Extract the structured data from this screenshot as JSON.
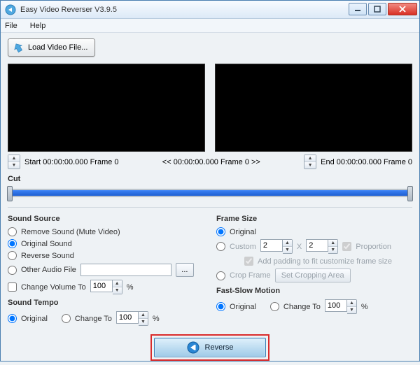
{
  "window": {
    "title": "Easy Video Reverser V3.9.5"
  },
  "menu": {
    "file": "File",
    "help": "Help"
  },
  "buttons": {
    "load": "Load Video File...",
    "browse": "...",
    "set_crop": "Set Cropping Area",
    "reverse": "Reverse"
  },
  "time": {
    "start": "Start 00:00:00.000 Frame 0",
    "center": "<< 00:00:00.000  Frame 0 >>",
    "end": "End 00:00:00.000  Frame 0"
  },
  "cut": {
    "label": "Cut"
  },
  "sound_source": {
    "title": "Sound Source",
    "remove": "Remove Sound (Mute Video)",
    "original": "Original Sound",
    "reverse": "Reverse Sound",
    "other": "Other Audio File",
    "other_value": "",
    "change_vol": "Change Volume To",
    "vol_value": "100",
    "pct": "%"
  },
  "sound_tempo": {
    "title": "Sound Tempo",
    "original": "Original",
    "change": "Change To",
    "value": "100",
    "pct": "%"
  },
  "frame_size": {
    "title": "Frame Size",
    "original": "Original",
    "custom": "Custom",
    "w": "2",
    "h": "2",
    "x": "X",
    "proportion": "Proportion",
    "padding": "Add padding to fit customize frame size",
    "crop": "Crop Frame"
  },
  "fast_slow": {
    "title": "Fast-Slow Motion",
    "original": "Original",
    "change": "Change To",
    "value": "100",
    "pct": "%"
  }
}
